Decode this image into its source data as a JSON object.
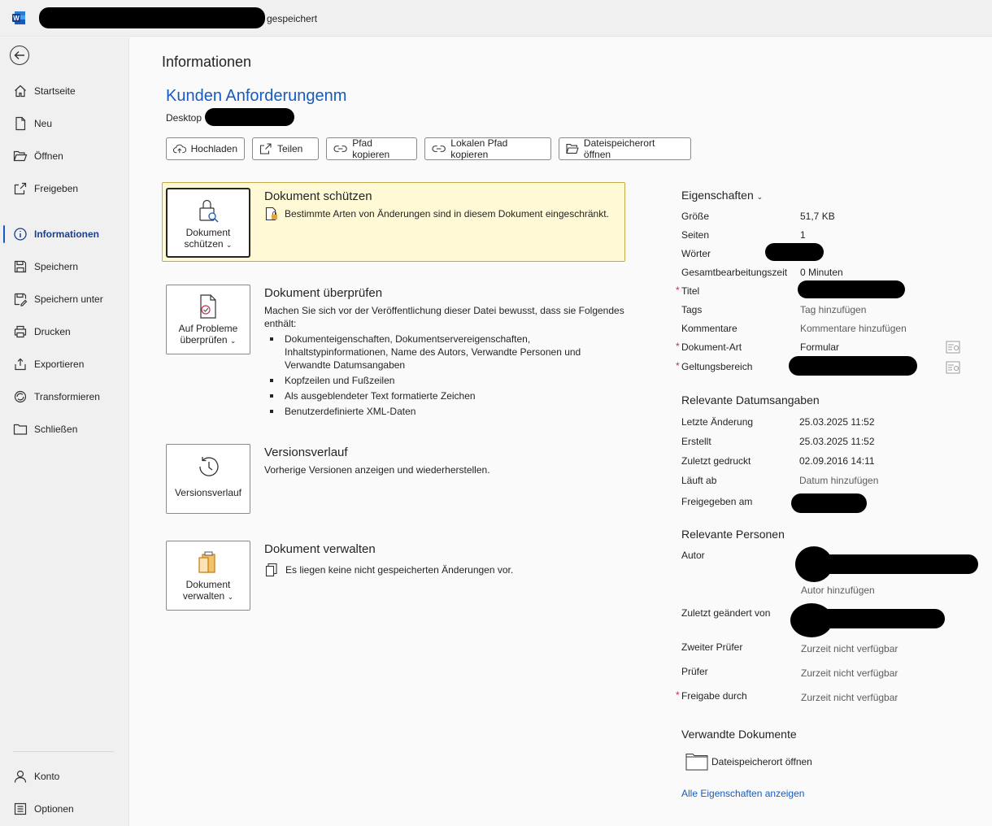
{
  "titlebar": {
    "status": "gespeichert",
    "app_icon": "word-icon"
  },
  "sidebar": {
    "items": [
      {
        "label": "Startseite",
        "icon": "home-icon"
      },
      {
        "label": "Neu",
        "icon": "new-document-icon"
      },
      {
        "label": "Öffnen",
        "icon": "folder-open-icon"
      },
      {
        "label": "Freigeben",
        "icon": "share-icon"
      },
      {
        "label": "Informationen",
        "icon": "info-icon"
      },
      {
        "label": "Speichern",
        "icon": "save-icon"
      },
      {
        "label": "Speichern unter",
        "icon": "save-as-icon"
      },
      {
        "label": "Drucken",
        "icon": "print-icon"
      },
      {
        "label": "Exportieren",
        "icon": "export-icon"
      },
      {
        "label": "Transformieren",
        "icon": "transform-icon"
      },
      {
        "label": "Schließen",
        "icon": "close-folder-icon"
      }
    ],
    "bottom": [
      {
        "label": "Konto",
        "icon": "person-icon"
      },
      {
        "label": "Optionen",
        "icon": "options-icon"
      }
    ]
  },
  "main": {
    "page_title": "Informationen",
    "doc_title": "Kunden Anforderungenm",
    "doc_path": "Desktop",
    "toolbar": [
      {
        "label": "Hochladen",
        "icon": "cloud-upload-icon"
      },
      {
        "label": "Teilen",
        "icon": "share-icon"
      },
      {
        "label": "Pfad kopieren",
        "icon": "link-icon"
      },
      {
        "label": "Lokalen Pfad kopieren",
        "icon": "link-icon"
      },
      {
        "label": "Dateispeicherort öffnen",
        "icon": "folder-icon"
      }
    ]
  },
  "sections": {
    "protect": {
      "tile_line1": "Dokument",
      "tile_line2": "schützen",
      "heading": "Dokument schützen",
      "text": "Bestimmte Arten von Änderungen sind in diesem Dokument eingeschränkt."
    },
    "inspect": {
      "tile_line1": "Auf Probleme",
      "tile_line2": "überprüfen",
      "heading": "Dokument überprüfen",
      "text": "Machen Sie sich vor der Veröffentlichung dieser Datei bewusst, dass sie Folgendes enthält:",
      "bullets": [
        "Dokumenteigenschaften, Dokumentservereigenschaften, Inhaltstypinformationen, Name des Autors, Verwandte Personen und Verwandte Datumsangaben",
        "Kopfzeilen und Fußzeilen",
        "Als ausgeblendeter Text formatierte Zeichen",
        "Benutzerdefinierte XML-Daten"
      ]
    },
    "versions": {
      "tile_line1": "Versionsverlauf",
      "heading": "Versionsverlauf",
      "text": "Vorherige Versionen anzeigen und wiederherstellen."
    },
    "manage": {
      "tile_line1": "Dokument",
      "tile_line2": "verwalten",
      "heading": "Dokument verwalten",
      "text": "Es liegen keine nicht gespeicherten Änderungen vor."
    }
  },
  "properties": {
    "heading": "Eigenschaften",
    "size_label": "Größe",
    "size_value": "51,7 KB",
    "pages_label": "Seiten",
    "pages_value": "1",
    "words_label": "Wörter",
    "edit_time_label": "Gesamtbearbeitungszeit",
    "edit_time_value": "0 Minuten",
    "title_label": "Titel",
    "tags_label": "Tags",
    "tags_value": "Tag hinzufügen",
    "comments_label": "Kommentare",
    "comments_value": "Kommentare hinzufügen",
    "doctype_label": "Dokument-Art",
    "doctype_value": "Formular",
    "scope_label": "Geltungsbereich",
    "required_mark": "*"
  },
  "dates": {
    "heading": "Relevante Datumsangaben",
    "last_modified_label": "Letzte Änderung",
    "last_modified_value": "25.03.2025 11:52",
    "created_label": "Erstellt",
    "created_value": "25.03.2025 11:52",
    "last_printed_label": "Zuletzt gedruckt",
    "last_printed_value": "02.09.2016 14:11",
    "expires_label": "Läuft ab",
    "expires_value": "Datum hinzufügen",
    "released_label": "Freigegeben am"
  },
  "people": {
    "heading": "Relevante Personen",
    "author_label": "Autor",
    "add_author": "Autor hinzufügen",
    "last_modified_by_label": "Zuletzt geändert von",
    "second_reviewer_label": "Zweiter Prüfer",
    "second_reviewer_value": "Zurzeit nicht verfügbar",
    "reviewer_label": "Prüfer",
    "reviewer_value": "Zurzeit nicht verfügbar",
    "release_by_label": "Freigabe durch",
    "release_by_value": "Zurzeit nicht verfügbar"
  },
  "related": {
    "heading": "Verwandte Dokumente",
    "open_location": "Dateispeicherort öffnen",
    "all_properties": "Alle Eigenschaften anzeigen"
  }
}
